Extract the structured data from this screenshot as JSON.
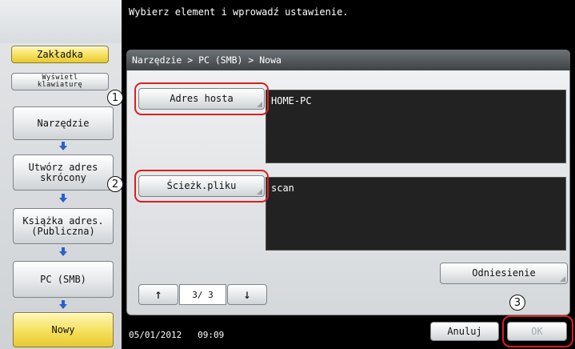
{
  "message": "Wybierz element i wprowadź ustawienie.",
  "sidebar": {
    "tab_bookmark": "Zakładka",
    "tab_keyboard_line1": "Wyświetl",
    "tab_keyboard_line2": "klawiaturę",
    "flow": [
      {
        "label": "Narzędzie"
      },
      {
        "label_line1": "Utwórz adres",
        "label_line2": "skrócony"
      },
      {
        "label_line1": "Książka adres.",
        "label_line2": "(Publiczna)"
      },
      {
        "label": "PC (SMB)"
      },
      {
        "label": "Nowy"
      }
    ]
  },
  "breadcrumb": "Narzędzie > PC (SMB) > Nowa",
  "fields": {
    "host": {
      "label": "Adres hosta",
      "value": "HOME-PC"
    },
    "path": {
      "label": "Ścieżk.pliku",
      "value": "scan"
    }
  },
  "reference_button": "Odniesienie",
  "pager": {
    "up_icon": "arrow-up",
    "down_icon": "arrow-down",
    "indicator": "3/ 3"
  },
  "footer": {
    "date": "05/01/2012",
    "time": "09:09"
  },
  "buttons": {
    "cancel": "Anuluj",
    "ok": "OK"
  },
  "callouts": {
    "one": "1",
    "two": "2",
    "three": "3"
  },
  "colors": {
    "highlight": "#d9201f",
    "active_yellow": "#f4dd55",
    "flow_arrow": "#2c5fc8"
  }
}
